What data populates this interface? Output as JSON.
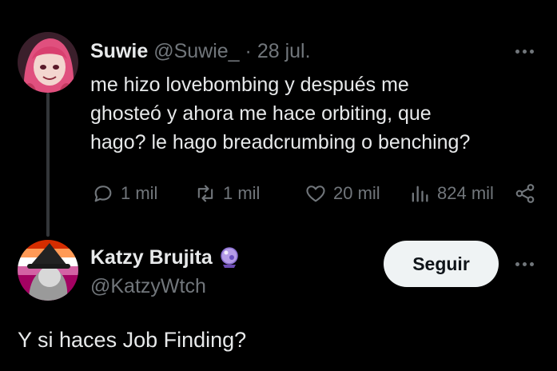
{
  "colors": {
    "background": "#000000",
    "text_primary": "#e7e9ea",
    "text_muted": "#71767b",
    "thread_line": "#333639",
    "follow_bg": "#eff3f4"
  },
  "tweet": {
    "author_name": "Suwie",
    "author_handle": "@Suwie_",
    "separator": "·",
    "date": "28 jul.",
    "text": "me hizo lovebombing y después me\nghosteó y ahora me hace orbiting, que\nhago? le hago breadcrumbing o benching?",
    "actions": {
      "replies": "1 mil",
      "retweets": "1 mil",
      "likes": "20 mil",
      "views": "824 mil"
    },
    "icons": {
      "more": "more-horizontal-icon",
      "reply": "reply-bubble-icon",
      "retweet": "retweet-icon",
      "like": "heart-icon",
      "views": "views-chart-icon",
      "share": "share-icon"
    }
  },
  "reply": {
    "author_name": "Katzy Brujita",
    "badge_icon": "crystal-ball-emoji-icon",
    "author_handle": "@KatzyWtch",
    "follow_label": "Seguir",
    "text": "Y si haces Job Finding?"
  }
}
